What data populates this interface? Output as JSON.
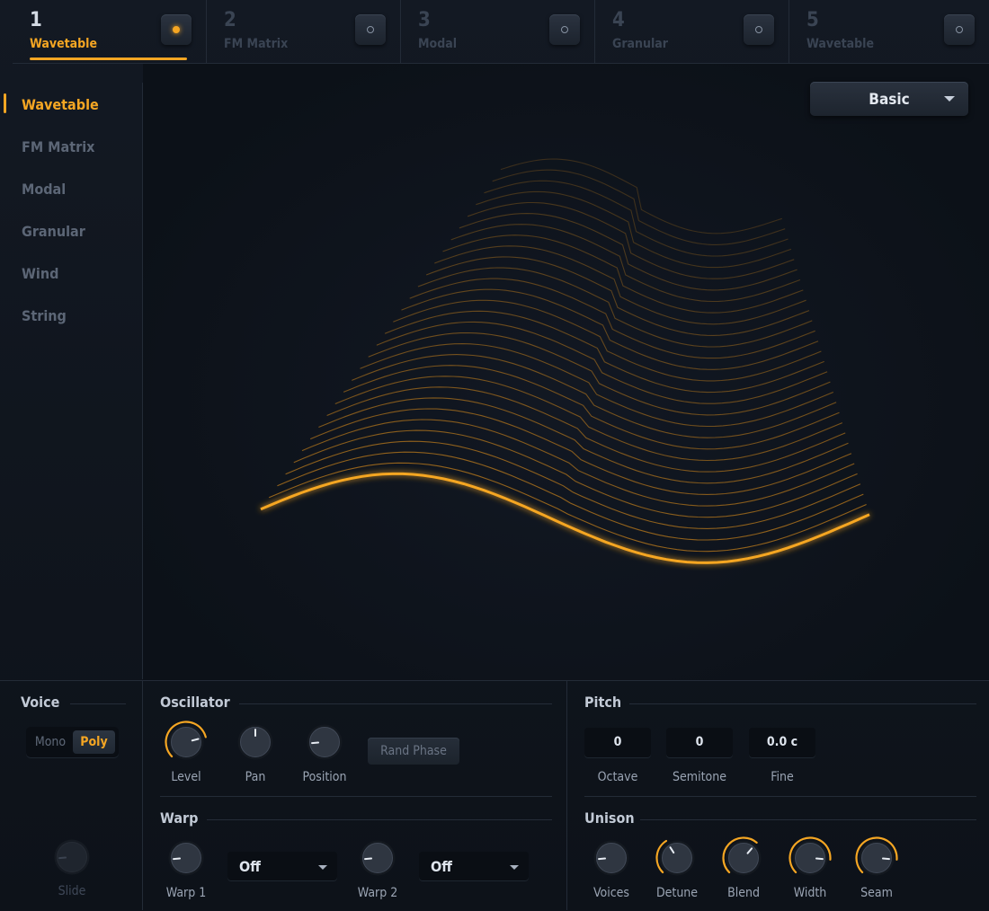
{
  "tabs": [
    {
      "num": "1",
      "name": "Wavetable",
      "active": true
    },
    {
      "num": "2",
      "name": "FM Matrix",
      "active": false
    },
    {
      "num": "3",
      "name": "Modal",
      "active": false
    },
    {
      "num": "4",
      "name": "Granular",
      "active": false
    },
    {
      "num": "5",
      "name": "Wavetable",
      "active": false
    }
  ],
  "sidebar": {
    "items": [
      {
        "label": "Wavetable"
      },
      {
        "label": "FM Matrix"
      },
      {
        "label": "Modal"
      },
      {
        "label": "Granular"
      },
      {
        "label": "Wind"
      },
      {
        "label": "String"
      }
    ]
  },
  "preset": {
    "label": "Basic"
  },
  "voice": {
    "title": "Voice",
    "mono": "Mono",
    "poly": "Poly",
    "selected": "Poly",
    "slide_label": "Slide"
  },
  "oscillator": {
    "title": "Oscillator",
    "level_label": "Level",
    "pan_label": "Pan",
    "position_label": "Position",
    "rand_phase": "Rand Phase"
  },
  "warp": {
    "title": "Warp",
    "warp1_label": "Warp 1",
    "warp2_label": "Warp 2",
    "warp1_mode": "Off",
    "warp2_mode": "Off"
  },
  "pitch": {
    "title": "Pitch",
    "octave": "0",
    "semitone": "0",
    "fine": "0.0 c",
    "octave_label": "Octave",
    "semitone_label": "Semitone",
    "fine_label": "Fine"
  },
  "unison": {
    "title": "Unison",
    "voices_label": "Voices",
    "detune_label": "Detune",
    "blend_label": "Blend",
    "width_label": "Width",
    "seam_label": "Seam"
  },
  "colors": {
    "accent": "#f5a623",
    "background": "#0e131b",
    "panel_line": "#232b37"
  }
}
